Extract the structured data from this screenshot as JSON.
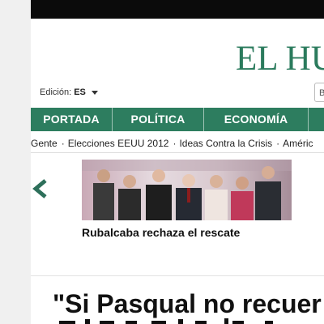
{
  "header": {
    "logo_text": "EL HU",
    "edition_label": "Edición:",
    "edition_value": "ES",
    "search_placeholder": "B"
  },
  "nav": {
    "items": [
      {
        "label": "PORTADA"
      },
      {
        "label": "POLÍTICA"
      },
      {
        "label": "ECONOMÍA"
      }
    ]
  },
  "subnav": {
    "items": [
      {
        "label": "Gente"
      },
      {
        "label": "Elecciones EEUU 2012"
      },
      {
        "label": "Ideas Contra la Crisis"
      },
      {
        "label": "Améric"
      }
    ],
    "separator": "·"
  },
  "feature": {
    "caption": "Rubalcaba rechaza el rescate"
  },
  "article": {
    "headline": "\"Si Pasqual no recuer"
  },
  "colors": {
    "brand_green": "#2d7d5f",
    "logo_green": "#2b7b5d",
    "topbar": "#0b0b0b"
  }
}
